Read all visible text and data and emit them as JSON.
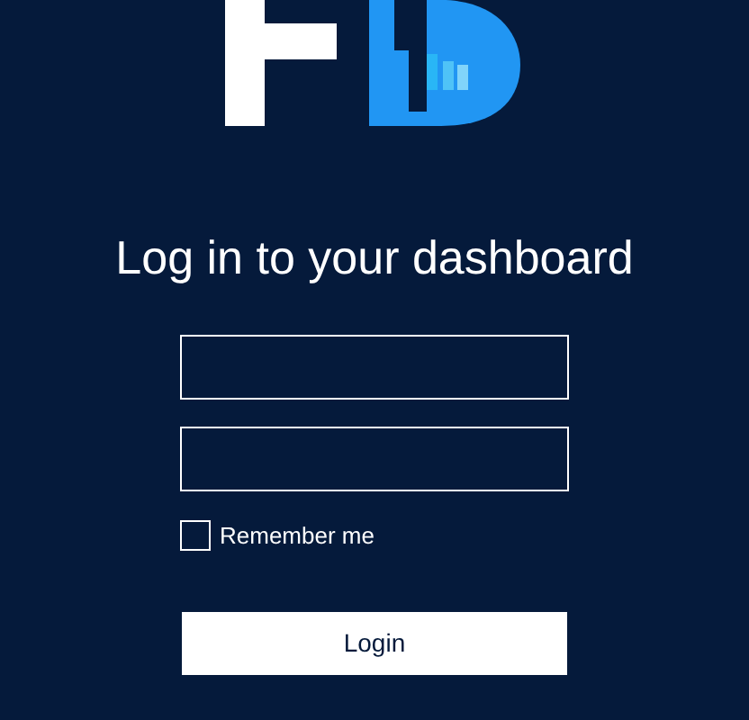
{
  "heading": "Log in to your dashboard",
  "fields": [
    {
      "kind": "input"
    },
    {
      "kind": "input"
    }
  ],
  "remember": {
    "label": "Remember me",
    "checked": false
  },
  "button": "Login"
}
